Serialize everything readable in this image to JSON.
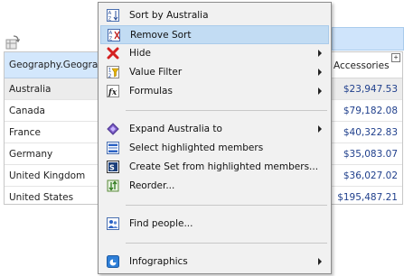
{
  "grid": {
    "header_geo": "Geography.Geography",
    "header_accessories": "Accessories",
    "expand_symbol": "+",
    "rows": [
      {
        "name": "Australia",
        "value": "$23,947.53"
      },
      {
        "name": "Canada",
        "value": "$79,182.08"
      },
      {
        "name": "France",
        "value": "$40,322.83"
      },
      {
        "name": "Germany",
        "value": "$35,083.07"
      },
      {
        "name": "United Kingdom",
        "value": "$36,027.02"
      },
      {
        "name": "United States",
        "value": "$195,487.21"
      }
    ]
  },
  "menu": {
    "items": [
      {
        "label": "Sort by Australia",
        "icon": "sort-icon"
      },
      {
        "label": "Remove Sort",
        "icon": "remove-sort-icon",
        "highlighted": true
      },
      {
        "label": "Hide",
        "icon": "hide-icon",
        "submenu": true
      },
      {
        "label": "Value Filter",
        "icon": "filter-icon",
        "submenu": true
      },
      {
        "label": "Formulas",
        "icon": "formula-icon",
        "submenu": true
      },
      {
        "label": "Expand Australia to",
        "icon": "expand-icon",
        "submenu": true
      },
      {
        "label": "Select highlighted members",
        "icon": "select-icon"
      },
      {
        "label": "Create Set from highlighted members...",
        "icon": "create-set-icon"
      },
      {
        "label": "Reorder...",
        "icon": "reorder-icon"
      },
      {
        "label": "Find people...",
        "icon": "find-people-icon"
      },
      {
        "label": "Infographics",
        "icon": "infographics-icon",
        "submenu": true
      }
    ]
  },
  "colors": {
    "highlight": "#c2dcf3",
    "header": "#d3e7fc",
    "value_text": "#1f3f8c"
  }
}
